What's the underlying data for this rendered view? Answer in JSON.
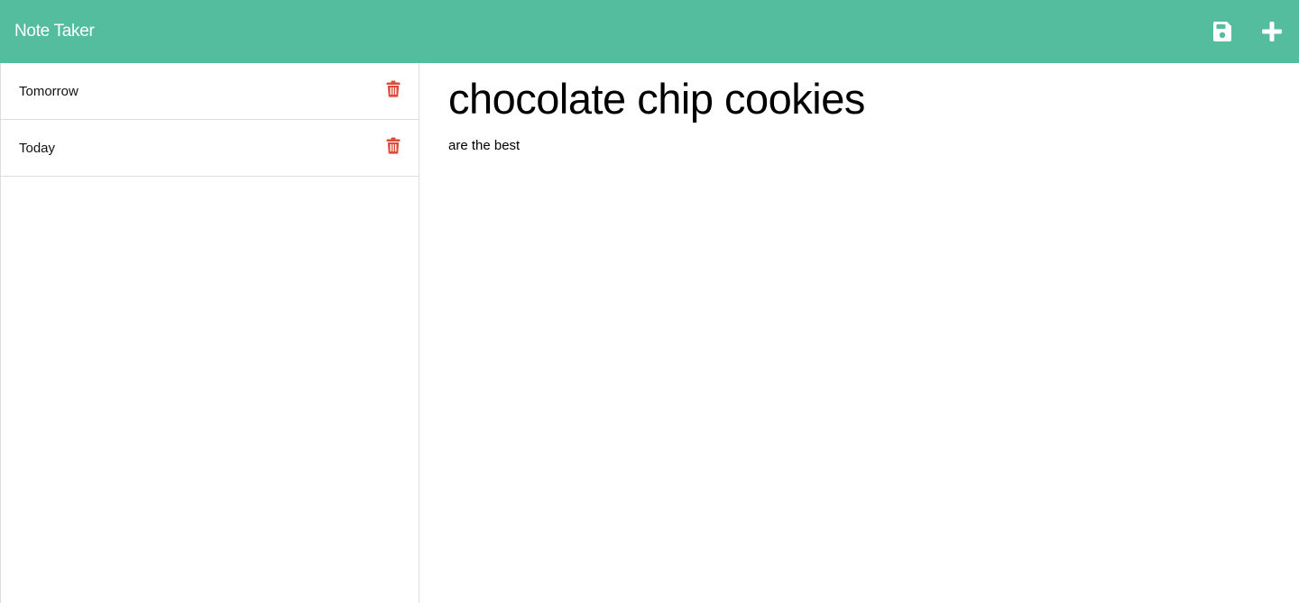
{
  "app": {
    "title": "Note Taker",
    "accent_color": "#53bd9d",
    "danger_color": "#dd4b39"
  },
  "toolbar": {
    "save_icon": "save-icon",
    "new_icon": "plus-icon"
  },
  "sidebar": {
    "notes": [
      {
        "title": "Tomorrow",
        "delete_icon": "trash-icon"
      },
      {
        "title": "Today",
        "delete_icon": "trash-icon"
      }
    ]
  },
  "editor": {
    "title": "chocolate chip cookies",
    "body": "are the best"
  }
}
